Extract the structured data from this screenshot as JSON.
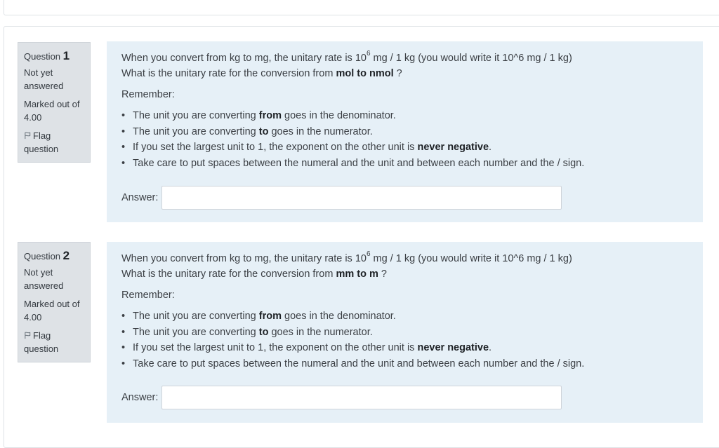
{
  "questions": [
    {
      "qword": "Question",
      "number": "1",
      "state_line1": "Not yet",
      "state_line2": "answered",
      "grade_line1": "Marked out of",
      "grade_line2": "4.00",
      "flag_line1": "Flag",
      "flag_line2": "question",
      "text_a": "When you convert from kg to mg, the unitary rate is 10",
      "text_sup": "6",
      "text_b": " mg / 1 kg (you would write it 10^6 mg / 1 kg)",
      "line2_a": "What is the unitary rate for the conversion from ",
      "line2_bold": "mol to nmol",
      "line2_b": " ?",
      "remember": "Remember:",
      "bullet1_a": "The unit you are converting ",
      "bullet1_bold": "from",
      "bullet1_b": " goes in the denominator.",
      "bullet2_a": "The unit you are converting ",
      "bullet2_bold": "to",
      "bullet2_b": " goes in the numerator.",
      "bullet3_a": "If you set the largest unit to 1, the exponent on the other unit is ",
      "bullet3_bold": "never negative",
      "bullet3_b": ".",
      "bullet4": "Take care to put spaces between the numeral and the unit and between each number and the / sign.",
      "answer_label": "Answer:",
      "answer_value": ""
    },
    {
      "qword": "Question",
      "number": "2",
      "state_line1": "Not yet",
      "state_line2": "answered",
      "grade_line1": "Marked out of",
      "grade_line2": "4.00",
      "flag_line1": "Flag",
      "flag_line2": "question",
      "text_a": "When you convert from kg to mg, the unitary rate is 10",
      "text_sup": "6",
      "text_b": " mg / 1 kg (you would write it 10^6 mg / 1 kg)",
      "line2_a": "What is the unitary rate for the conversion from ",
      "line2_bold": "mm to m",
      "line2_b": " ?",
      "remember": "Remember:",
      "bullet1_a": "The unit you are converting ",
      "bullet1_bold": "from",
      "bullet1_b": " goes in the denominator.",
      "bullet2_a": "The unit you are converting ",
      "bullet2_bold": "to",
      "bullet2_b": " goes in the numerator.",
      "bullet3_a": "If you set the largest unit to 1, the exponent on the other unit is ",
      "bullet3_bold": "never negative",
      "bullet3_b": ".",
      "bullet4": "Take care to put spaces between the numeral and the unit and between each number and the / sign.",
      "answer_label": "Answer:",
      "answer_value": ""
    }
  ]
}
